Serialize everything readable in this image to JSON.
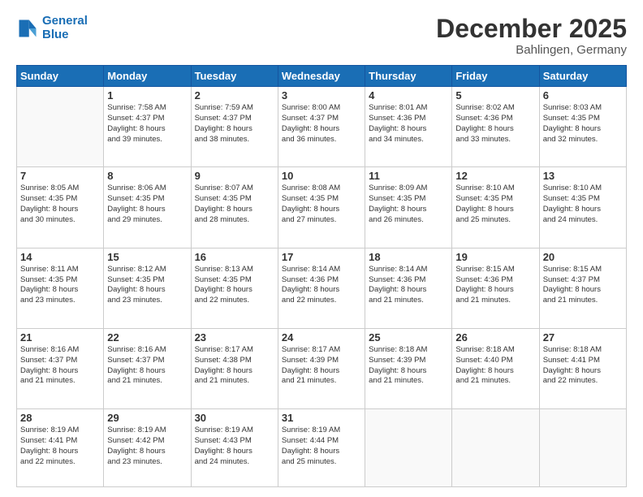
{
  "header": {
    "logo_line1": "General",
    "logo_line2": "Blue",
    "month": "December 2025",
    "location": "Bahlingen, Germany"
  },
  "weekdays": [
    "Sunday",
    "Monday",
    "Tuesday",
    "Wednesday",
    "Thursday",
    "Friday",
    "Saturday"
  ],
  "weeks": [
    [
      {
        "day": "",
        "text": ""
      },
      {
        "day": "1",
        "text": "Sunrise: 7:58 AM\nSunset: 4:37 PM\nDaylight: 8 hours\nand 39 minutes."
      },
      {
        "day": "2",
        "text": "Sunrise: 7:59 AM\nSunset: 4:37 PM\nDaylight: 8 hours\nand 38 minutes."
      },
      {
        "day": "3",
        "text": "Sunrise: 8:00 AM\nSunset: 4:37 PM\nDaylight: 8 hours\nand 36 minutes."
      },
      {
        "day": "4",
        "text": "Sunrise: 8:01 AM\nSunset: 4:36 PM\nDaylight: 8 hours\nand 34 minutes."
      },
      {
        "day": "5",
        "text": "Sunrise: 8:02 AM\nSunset: 4:36 PM\nDaylight: 8 hours\nand 33 minutes."
      },
      {
        "day": "6",
        "text": "Sunrise: 8:03 AM\nSunset: 4:35 PM\nDaylight: 8 hours\nand 32 minutes."
      }
    ],
    [
      {
        "day": "7",
        "text": "Sunrise: 8:05 AM\nSunset: 4:35 PM\nDaylight: 8 hours\nand 30 minutes."
      },
      {
        "day": "8",
        "text": "Sunrise: 8:06 AM\nSunset: 4:35 PM\nDaylight: 8 hours\nand 29 minutes."
      },
      {
        "day": "9",
        "text": "Sunrise: 8:07 AM\nSunset: 4:35 PM\nDaylight: 8 hours\nand 28 minutes."
      },
      {
        "day": "10",
        "text": "Sunrise: 8:08 AM\nSunset: 4:35 PM\nDaylight: 8 hours\nand 27 minutes."
      },
      {
        "day": "11",
        "text": "Sunrise: 8:09 AM\nSunset: 4:35 PM\nDaylight: 8 hours\nand 26 minutes."
      },
      {
        "day": "12",
        "text": "Sunrise: 8:10 AM\nSunset: 4:35 PM\nDaylight: 8 hours\nand 25 minutes."
      },
      {
        "day": "13",
        "text": "Sunrise: 8:10 AM\nSunset: 4:35 PM\nDaylight: 8 hours\nand 24 minutes."
      }
    ],
    [
      {
        "day": "14",
        "text": "Sunrise: 8:11 AM\nSunset: 4:35 PM\nDaylight: 8 hours\nand 23 minutes."
      },
      {
        "day": "15",
        "text": "Sunrise: 8:12 AM\nSunset: 4:35 PM\nDaylight: 8 hours\nand 23 minutes."
      },
      {
        "day": "16",
        "text": "Sunrise: 8:13 AM\nSunset: 4:35 PM\nDaylight: 8 hours\nand 22 minutes."
      },
      {
        "day": "17",
        "text": "Sunrise: 8:14 AM\nSunset: 4:36 PM\nDaylight: 8 hours\nand 22 minutes."
      },
      {
        "day": "18",
        "text": "Sunrise: 8:14 AM\nSunset: 4:36 PM\nDaylight: 8 hours\nand 21 minutes."
      },
      {
        "day": "19",
        "text": "Sunrise: 8:15 AM\nSunset: 4:36 PM\nDaylight: 8 hours\nand 21 minutes."
      },
      {
        "day": "20",
        "text": "Sunrise: 8:15 AM\nSunset: 4:37 PM\nDaylight: 8 hours\nand 21 minutes."
      }
    ],
    [
      {
        "day": "21",
        "text": "Sunrise: 8:16 AM\nSunset: 4:37 PM\nDaylight: 8 hours\nand 21 minutes."
      },
      {
        "day": "22",
        "text": "Sunrise: 8:16 AM\nSunset: 4:37 PM\nDaylight: 8 hours\nand 21 minutes."
      },
      {
        "day": "23",
        "text": "Sunrise: 8:17 AM\nSunset: 4:38 PM\nDaylight: 8 hours\nand 21 minutes."
      },
      {
        "day": "24",
        "text": "Sunrise: 8:17 AM\nSunset: 4:39 PM\nDaylight: 8 hours\nand 21 minutes."
      },
      {
        "day": "25",
        "text": "Sunrise: 8:18 AM\nSunset: 4:39 PM\nDaylight: 8 hours\nand 21 minutes."
      },
      {
        "day": "26",
        "text": "Sunrise: 8:18 AM\nSunset: 4:40 PM\nDaylight: 8 hours\nand 21 minutes."
      },
      {
        "day": "27",
        "text": "Sunrise: 8:18 AM\nSunset: 4:41 PM\nDaylight: 8 hours\nand 22 minutes."
      }
    ],
    [
      {
        "day": "28",
        "text": "Sunrise: 8:19 AM\nSunset: 4:41 PM\nDaylight: 8 hours\nand 22 minutes."
      },
      {
        "day": "29",
        "text": "Sunrise: 8:19 AM\nSunset: 4:42 PM\nDaylight: 8 hours\nand 23 minutes."
      },
      {
        "day": "30",
        "text": "Sunrise: 8:19 AM\nSunset: 4:43 PM\nDaylight: 8 hours\nand 24 minutes."
      },
      {
        "day": "31",
        "text": "Sunrise: 8:19 AM\nSunset: 4:44 PM\nDaylight: 8 hours\nand 25 minutes."
      },
      {
        "day": "",
        "text": ""
      },
      {
        "day": "",
        "text": ""
      },
      {
        "day": "",
        "text": ""
      }
    ]
  ]
}
